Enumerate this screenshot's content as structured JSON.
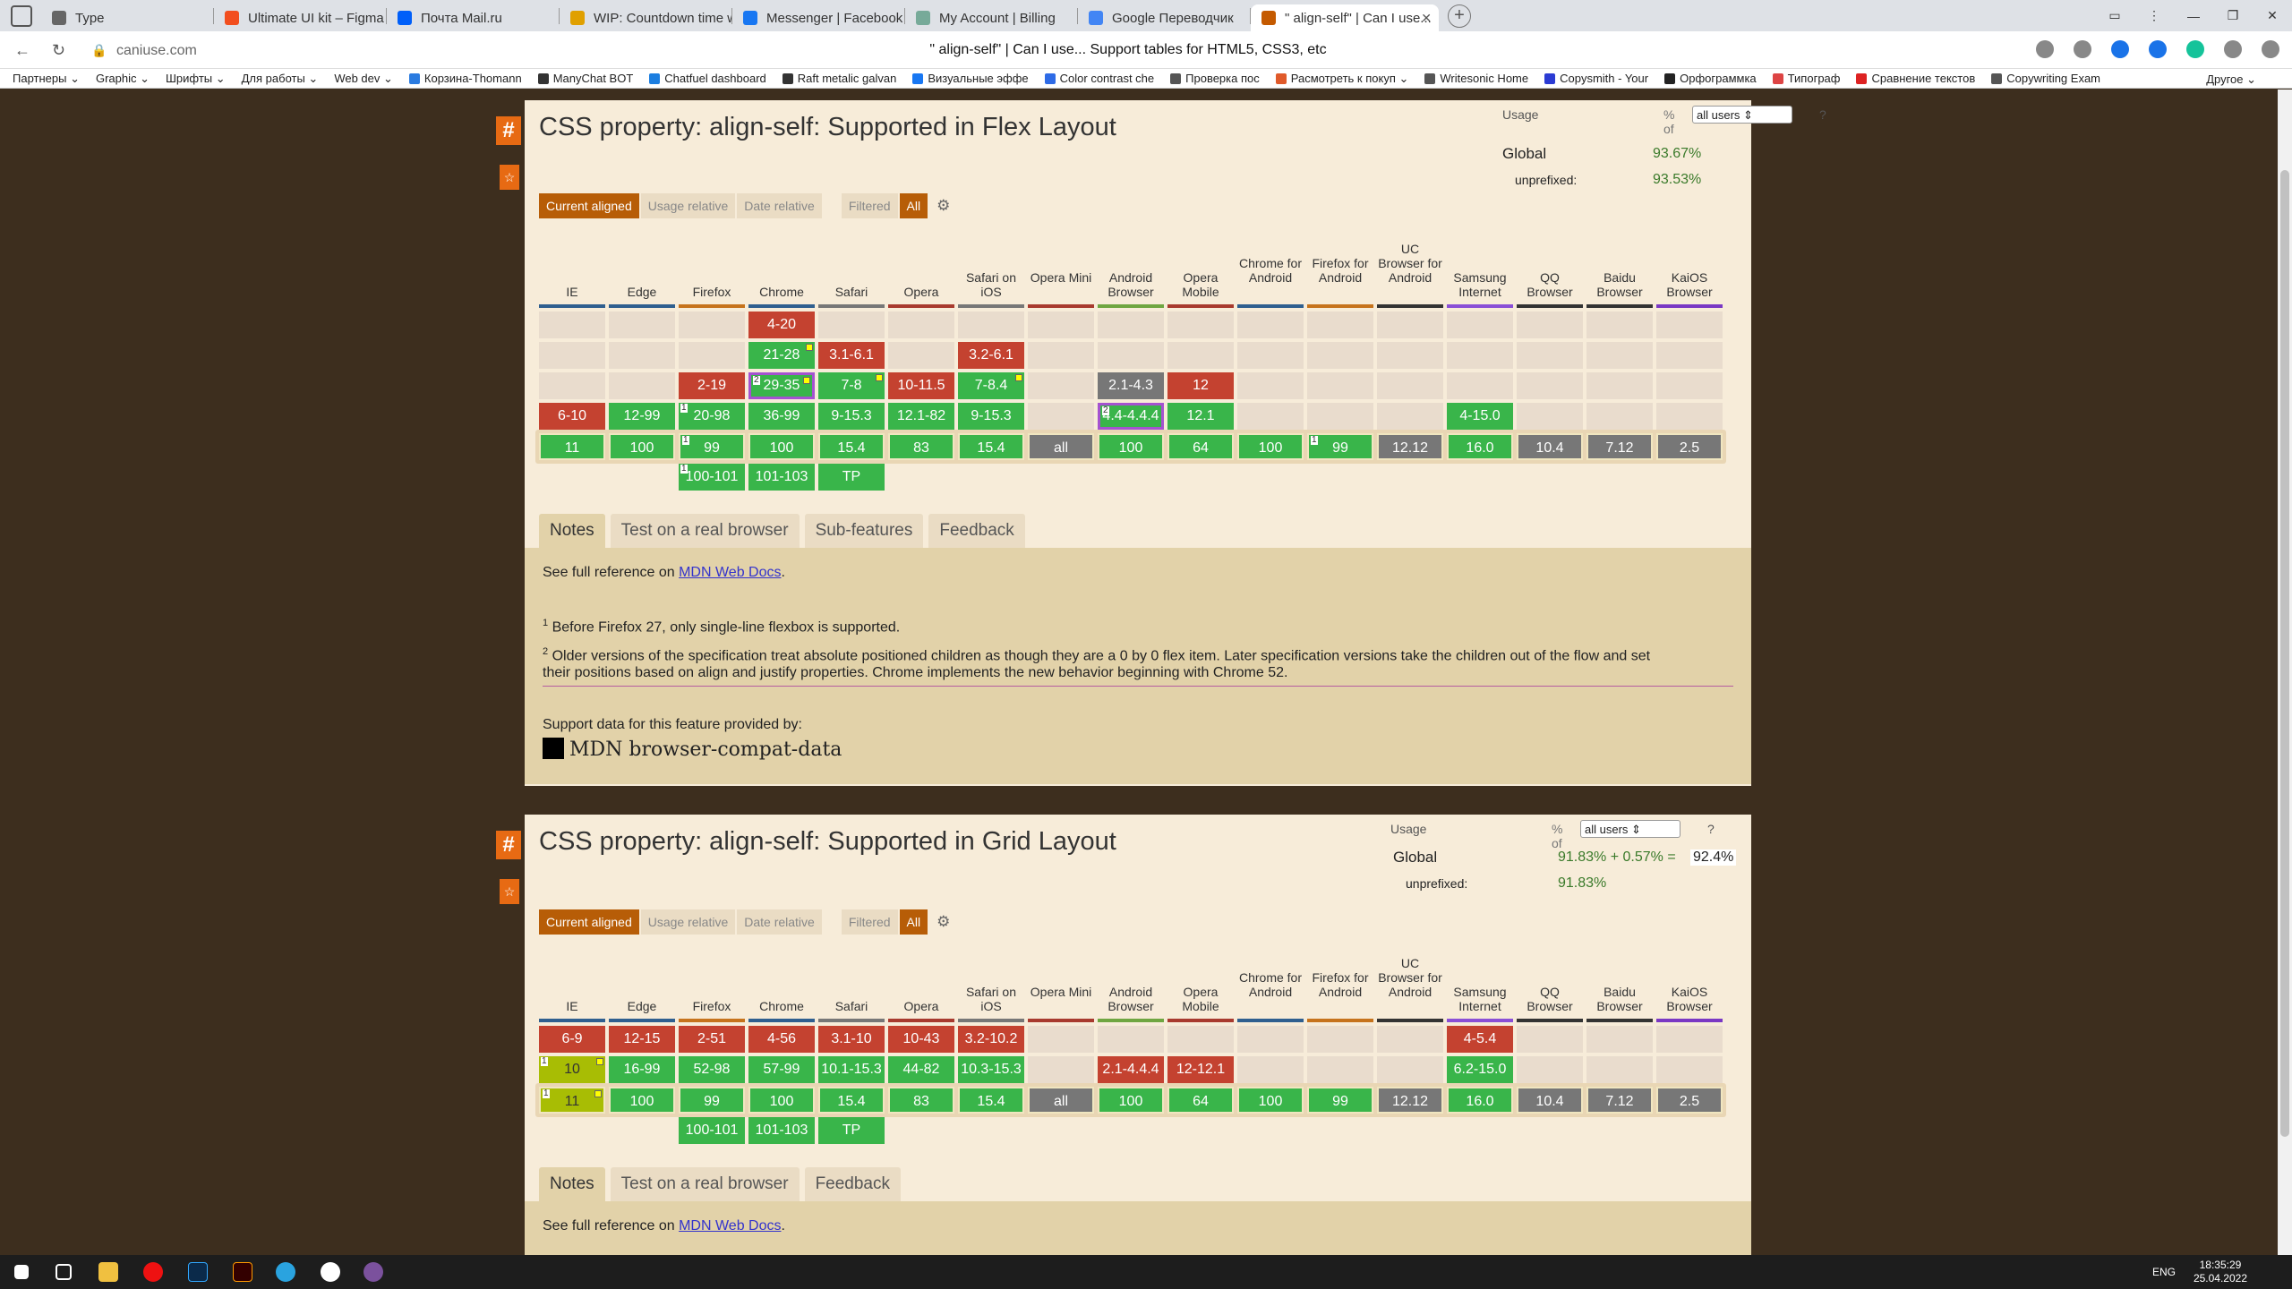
{
  "browser": {
    "tabs": [
      {
        "title": "Type",
        "color": "#666"
      },
      {
        "title": "Ultimate UI kit – Figma",
        "color": "#f24e1e"
      },
      {
        "title": "Почта Mail.ru",
        "color": "#005ff9"
      },
      {
        "title": "WIP: Countdown time widg",
        "color": "#e0a000"
      },
      {
        "title": "Messenger | Facebook",
        "color": "#1877f2"
      },
      {
        "title": "My Account | Billing",
        "color": "#7a9"
      },
      {
        "title": "Google Переводчик",
        "color": "#4285f4"
      },
      {
        "title": "\" align-self\" | Can I use...",
        "color": "#c45a00"
      }
    ],
    "window_controls": [
      "▭",
      "⋮",
      "—",
      "❐",
      "✕"
    ],
    "url_host": "caniuse.com",
    "page_title": "\" align-self\" | Can I use... Support tables for HTML5, CSS3, etc",
    "bookmarks": [
      "Партнеры ⌄",
      "Graphic ⌄",
      "Шрифты ⌄",
      "Для работы ⌄",
      "Web dev ⌄",
      "Корзина-Thomann",
      "ManyChat BOT",
      "Chatfuel dashboard",
      "Raft metalic galvan",
      "Визуальные эффе",
      "Color contrast che",
      "Проверка пос",
      "Расмотреть к покуп ⌄",
      "Writesonic Home",
      "Copysmith - Your",
      "Орфограммка",
      "Типограф",
      "Сравнение текстов",
      "Copywriting Exam"
    ],
    "bookmarks_other": "Другое ⌄"
  },
  "browsers": [
    "IE",
    "Edge",
    "Firefox",
    "Chrome",
    "Safari",
    "Opera",
    "Safari on iOS",
    "Opera Mini",
    "Android Browser",
    "Opera Mobile",
    "Chrome for Android",
    "Firefox for Android",
    "UC Browser for Android",
    "Samsung Internet",
    "QQ Browser",
    "Baidu Browser",
    "KaiOS Browser"
  ],
  "browser_colors": [
    "#2f5f8f",
    "#2f5f8f",
    "#c6731c",
    "#2f5f8f",
    "#777",
    "#a83a2e",
    "#777",
    "#a83a2e",
    "#6fa641",
    "#a83a2e",
    "#2f5f8f",
    "#c6731c",
    "#333",
    "#8a4fd6",
    "#333",
    "#333",
    "#7a38c4"
  ],
  "features": [
    {
      "title": "CSS property: align-self: Supported in Flex Layout",
      "usage": {
        "label": "Usage",
        "pct_of": "% of",
        "select": "all users",
        "help": "?",
        "global": "Global",
        "global_value": "93.67%",
        "unprefixed": "unprefixed:",
        "unprefixed_value": "93.53%"
      },
      "view_buttons": [
        "Current aligned",
        "Usage relative",
        "Date relative",
        "Filtered",
        "All",
        "⚙"
      ],
      "rows": [
        [
          null,
          null,
          null,
          {
            "t": "4-20",
            "s": "n"
          },
          null,
          null,
          null,
          null,
          null,
          null,
          null,
          null,
          null,
          null,
          null,
          null,
          null
        ],
        [
          null,
          null,
          null,
          {
            "t": "21-28",
            "s": "y",
            "m": 1
          },
          {
            "t": "3.1-6.1",
            "s": "n"
          },
          null,
          {
            "t": "3.2-6.1",
            "s": "n"
          },
          null,
          null,
          null,
          null,
          null,
          null,
          null,
          null,
          null,
          null
        ],
        [
          null,
          null,
          {
            "t": "2-19",
            "s": "n"
          },
          {
            "t": "29-35",
            "s": "y",
            "m": 1,
            "note": "2",
            "hl": 1
          },
          {
            "t": "7-8",
            "s": "y",
            "m": 1
          },
          {
            "t": "10-11.5",
            "s": "n"
          },
          {
            "t": "7-8.4",
            "s": "y",
            "m": 1
          },
          null,
          {
            "t": "2.1-4.3",
            "s": "u"
          },
          {
            "t": "12",
            "s": "n"
          },
          null,
          null,
          null,
          null,
          null,
          null,
          null
        ],
        [
          {
            "t": "6-10",
            "s": "n"
          },
          {
            "t": "12-99",
            "s": "y"
          },
          {
            "t": "20-98",
            "s": "y",
            "note": "1"
          },
          {
            "t": "36-99",
            "s": "y"
          },
          {
            "t": "9-15.3",
            "s": "y"
          },
          {
            "t": "12.1-82",
            "s": "y"
          },
          {
            "t": "9-15.3",
            "s": "y"
          },
          null,
          {
            "t": "4.4-4.4.4",
            "s": "y",
            "note": "2",
            "hl": 1
          },
          {
            "t": "12.1",
            "s": "y"
          },
          null,
          null,
          null,
          {
            "t": "4-15.0",
            "s": "y"
          },
          null,
          null,
          null
        ],
        [
          {
            "t": "11",
            "s": "y"
          },
          {
            "t": "100",
            "s": "y"
          },
          {
            "t": "99",
            "s": "y",
            "note": "1"
          },
          {
            "t": "100",
            "s": "y"
          },
          {
            "t": "15.4",
            "s": "y"
          },
          {
            "t": "83",
            "s": "y"
          },
          {
            "t": "15.4",
            "s": "y"
          },
          {
            "t": "all",
            "s": "u"
          },
          {
            "t": "100",
            "s": "y"
          },
          {
            "t": "64",
            "s": "y"
          },
          {
            "t": "100",
            "s": "y"
          },
          {
            "t": "99",
            "s": "y",
            "note": "1"
          },
          {
            "t": "12.12",
            "s": "u"
          },
          {
            "t": "16.0",
            "s": "y"
          },
          {
            "t": "10.4",
            "s": "u"
          },
          {
            "t": "7.12",
            "s": "u"
          },
          {
            "t": "2.5",
            "s": "u"
          }
        ],
        [
          null,
          null,
          {
            "t": "100-101",
            "s": "y",
            "note": "1"
          },
          {
            "t": "101-103",
            "s": "y"
          },
          {
            "t": "TP",
            "s": "y"
          },
          null,
          null,
          null,
          null,
          null,
          null,
          null,
          null,
          null,
          null,
          null,
          null
        ]
      ],
      "tabs": [
        "Notes",
        "Test on a real browser",
        "Sub-features",
        "Feedback"
      ],
      "notes": {
        "ref_prefix": "See full reference on ",
        "ref_link": "MDN Web Docs",
        "ref_suffix": ".",
        "n1_mark": "1",
        "n1": " Before Firefox 27, only single-line flexbox is supported.",
        "n2_mark": "2",
        "n2a": " Older versions of the specification treat absolute positioned children as though they are a 0 by 0 flex item. Later specification versions take the children out of the flow and set",
        "n2b": "their positions based on align and justify properties. Chrome implements the new behavior beginning with Chrome 52.",
        "support_by": "Support data for this feature provided by:",
        "mdn": "MDN browser-compat-data"
      }
    },
    {
      "title": "CSS property: align-self: Supported in Grid Layout",
      "usage": {
        "label": "Usage",
        "pct_of": "% of",
        "select": "all users",
        "help": "?",
        "global": "Global",
        "global_value": "91.83% + 0.57% =",
        "global_total": "92.4%",
        "unprefixed": "unprefixed:",
        "unprefixed_value": "91.83%"
      },
      "view_buttons": [
        "Current aligned",
        "Usage relative",
        "Date relative",
        "Filtered",
        "All",
        "⚙"
      ],
      "rows": [
        [
          {
            "t": "6-9",
            "s": "n"
          },
          {
            "t": "12-15",
            "s": "n"
          },
          {
            "t": "2-51",
            "s": "n"
          },
          {
            "t": "4-56",
            "s": "n"
          },
          {
            "t": "3.1-10",
            "s": "n"
          },
          {
            "t": "10-43",
            "s": "n"
          },
          {
            "t": "3.2-10.2",
            "s": "n"
          },
          null,
          null,
          null,
          null,
          null,
          null,
          {
            "t": "4-5.4",
            "s": "n"
          },
          null,
          null,
          null
        ],
        [
          {
            "t": "10",
            "s": "p",
            "m": 1,
            "note": "1"
          },
          {
            "t": "16-99",
            "s": "y"
          },
          {
            "t": "52-98",
            "s": "y"
          },
          {
            "t": "57-99",
            "s": "y"
          },
          {
            "t": "10.1-15.3",
            "s": "y"
          },
          {
            "t": "44-82",
            "s": "y"
          },
          {
            "t": "10.3-15.3",
            "s": "y"
          },
          null,
          {
            "t": "2.1-4.4.4",
            "s": "n"
          },
          {
            "t": "12-12.1",
            "s": "n"
          },
          null,
          null,
          null,
          {
            "t": "6.2-15.0",
            "s": "y"
          },
          null,
          null,
          null
        ],
        [
          {
            "t": "11",
            "s": "p",
            "m": 1,
            "note": "1"
          },
          {
            "t": "100",
            "s": "y"
          },
          {
            "t": "99",
            "s": "y"
          },
          {
            "t": "100",
            "s": "y"
          },
          {
            "t": "15.4",
            "s": "y"
          },
          {
            "t": "83",
            "s": "y"
          },
          {
            "t": "15.4",
            "s": "y"
          },
          {
            "t": "all",
            "s": "u"
          },
          {
            "t": "100",
            "s": "y"
          },
          {
            "t": "64",
            "s": "y"
          },
          {
            "t": "100",
            "s": "y"
          },
          {
            "t": "99",
            "s": "y"
          },
          {
            "t": "12.12",
            "s": "u"
          },
          {
            "t": "16.0",
            "s": "y"
          },
          {
            "t": "10.4",
            "s": "u"
          },
          {
            "t": "7.12",
            "s": "u"
          },
          {
            "t": "2.5",
            "s": "u"
          }
        ],
        [
          null,
          null,
          {
            "t": "100-101",
            "s": "y"
          },
          {
            "t": "101-103",
            "s": "y"
          },
          {
            "t": "TP",
            "s": "y"
          },
          null,
          null,
          null,
          null,
          null,
          null,
          null,
          null,
          null,
          null,
          null,
          null
        ]
      ],
      "tabs": [
        "Notes",
        "Test on a real browser",
        "Feedback"
      ],
      "notes": {
        "ref_prefix": "See full reference on ",
        "ref_link": "MDN Web Docs",
        "ref_suffix": "."
      }
    }
  ],
  "taskbar": {
    "lang": "ENG",
    "time": "18:35:29",
    "date": "25.04.2022"
  }
}
